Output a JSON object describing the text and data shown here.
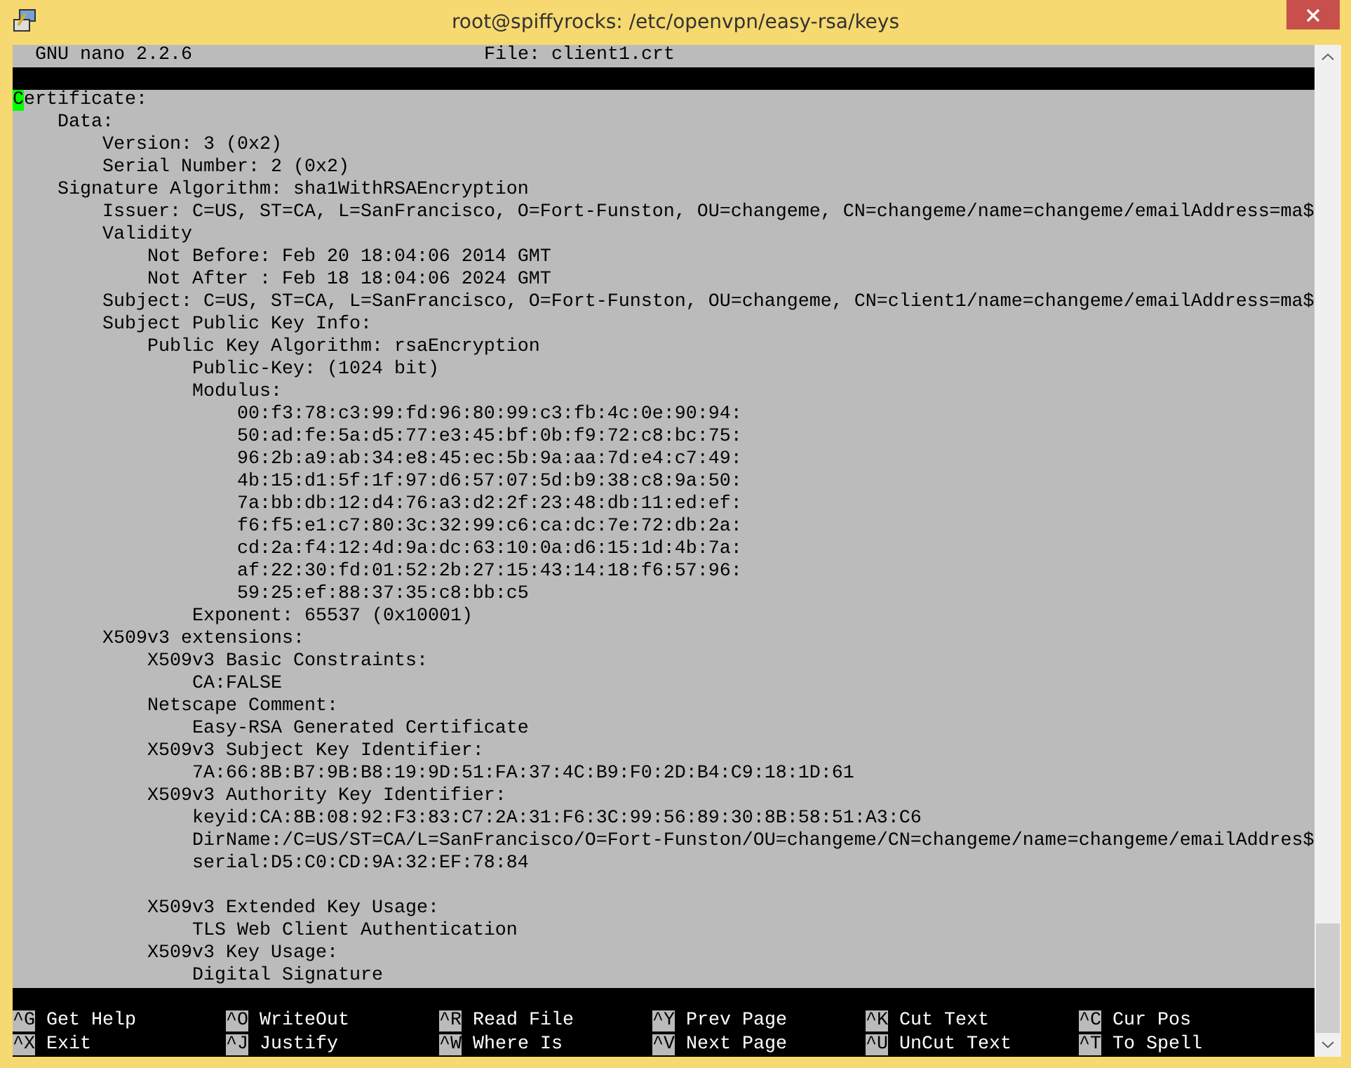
{
  "window": {
    "title": "root@spiffyrocks: /etc/openvpn/easy-rsa/keys"
  },
  "header": {
    "app": "  GNU nano 2.2.6",
    "file": "File: client1.crt"
  },
  "lines": [
    {
      "kind": "text",
      "text": "Certificate:",
      "has_cursor": true
    },
    {
      "kind": "text",
      "text": "    Data:",
      "has_cursor": false
    },
    {
      "kind": "text",
      "text": "        Version: 3 (0x2)",
      "has_cursor": false
    },
    {
      "kind": "text",
      "text": "        Serial Number: 2 (0x2)",
      "has_cursor": false
    },
    {
      "kind": "text",
      "text": "    Signature Algorithm: sha1WithRSAEncryption",
      "has_cursor": false
    },
    {
      "kind": "text",
      "text": "        Issuer: C=US, ST=CA, L=SanFrancisco, O=Fort-Funston, OU=changeme, CN=changeme/name=changeme/emailAddress=ma$",
      "has_cursor": false
    },
    {
      "kind": "text",
      "text": "        Validity",
      "has_cursor": false
    },
    {
      "kind": "text",
      "text": "            Not Before: Feb 20 18:04:06 2014 GMT",
      "has_cursor": false
    },
    {
      "kind": "text",
      "text": "            Not After : Feb 18 18:04:06 2024 GMT",
      "has_cursor": false
    },
    {
      "kind": "text",
      "text": "        Subject: C=US, ST=CA, L=SanFrancisco, O=Fort-Funston, OU=changeme, CN=client1/name=changeme/emailAddress=ma$",
      "has_cursor": false
    },
    {
      "kind": "text",
      "text": "        Subject Public Key Info:",
      "has_cursor": false
    },
    {
      "kind": "text",
      "text": "            Public Key Algorithm: rsaEncryption",
      "has_cursor": false
    },
    {
      "kind": "text",
      "text": "                Public-Key: (1024 bit)",
      "has_cursor": false
    },
    {
      "kind": "text",
      "text": "                Modulus:",
      "has_cursor": false
    },
    {
      "kind": "text",
      "text": "                    00:f3:78:c3:99:fd:96:80:99:c3:fb:4c:0e:90:94:",
      "has_cursor": false
    },
    {
      "kind": "text",
      "text": "                    50:ad:fe:5a:d5:77:e3:45:bf:0b:f9:72:c8:bc:75:",
      "has_cursor": false
    },
    {
      "kind": "text",
      "text": "                    96:2b:a9:ab:34:e8:45:ec:5b:9a:aa:7d:e4:c7:49:",
      "has_cursor": false
    },
    {
      "kind": "text",
      "text": "                    4b:15:d1:5f:1f:97:d6:57:07:5d:b9:38:c8:9a:50:",
      "has_cursor": false
    },
    {
      "kind": "text",
      "text": "                    7a:bb:db:12:d4:76:a3:d2:2f:23:48:db:11:ed:ef:",
      "has_cursor": false
    },
    {
      "kind": "text",
      "text": "                    f6:f5:e1:c7:80:3c:32:99:c6:ca:dc:7e:72:db:2a:",
      "has_cursor": false
    },
    {
      "kind": "text",
      "text": "                    cd:2a:f4:12:4d:9a:dc:63:10:0a:d6:15:1d:4b:7a:",
      "has_cursor": false
    },
    {
      "kind": "text",
      "text": "                    af:22:30:fd:01:52:2b:27:15:43:14:18:f6:57:96:",
      "has_cursor": false
    },
    {
      "kind": "text",
      "text": "                    59:25:ef:88:37:35:c8:bb:c5",
      "has_cursor": false
    },
    {
      "kind": "text",
      "text": "                Exponent: 65537 (0x10001)",
      "has_cursor": false
    },
    {
      "kind": "text",
      "text": "        X509v3 extensions:",
      "has_cursor": false
    },
    {
      "kind": "text",
      "text": "            X509v3 Basic Constraints:",
      "has_cursor": false
    },
    {
      "kind": "text",
      "text": "                CA:FALSE",
      "has_cursor": false
    },
    {
      "kind": "text",
      "text": "            Netscape Comment:",
      "has_cursor": false
    },
    {
      "kind": "text",
      "text": "                Easy-RSA Generated Certificate",
      "has_cursor": false
    },
    {
      "kind": "text",
      "text": "            X509v3 Subject Key Identifier:",
      "has_cursor": false
    },
    {
      "kind": "text",
      "text": "                7A:66:8B:B7:9B:B8:19:9D:51:FA:37:4C:B9:F0:2D:B4:C9:18:1D:61",
      "has_cursor": false
    },
    {
      "kind": "text",
      "text": "            X509v3 Authority Key Identifier:",
      "has_cursor": false
    },
    {
      "kind": "text",
      "text": "                keyid:CA:8B:08:92:F3:83:C7:2A:31:F6:3C:99:56:89:30:8B:58:51:A3:C6",
      "has_cursor": false
    },
    {
      "kind": "text",
      "text": "                DirName:/C=US/ST=CA/L=SanFrancisco/O=Fort-Funston/OU=changeme/CN=changeme/name=changeme/emailAddres$",
      "has_cursor": false
    },
    {
      "kind": "text",
      "text": "                serial:D5:C0:CD:9A:32:EF:78:84",
      "has_cursor": false
    },
    {
      "kind": "blank"
    },
    {
      "kind": "text",
      "text": "            X509v3 Extended Key Usage:",
      "has_cursor": false
    },
    {
      "kind": "text",
      "text": "                TLS Web Client Authentication",
      "has_cursor": false
    },
    {
      "kind": "text",
      "text": "            X509v3 Key Usage:",
      "has_cursor": false
    },
    {
      "kind": "text",
      "text": "                Digital Signature",
      "has_cursor": false
    }
  ],
  "shortcuts": [
    {
      "key": "^G",
      "label": "Get Help"
    },
    {
      "key": "^O",
      "label": "WriteOut"
    },
    {
      "key": "^R",
      "label": "Read File"
    },
    {
      "key": "^Y",
      "label": "Prev Page"
    },
    {
      "key": "^K",
      "label": "Cut Text"
    },
    {
      "key": "^C",
      "label": "Cur Pos"
    },
    {
      "key": "^X",
      "label": "Exit"
    },
    {
      "key": "^J",
      "label": "Justify"
    },
    {
      "key": "^W",
      "label": "Where Is"
    },
    {
      "key": "^V",
      "label": "Next Page"
    },
    {
      "key": "^U",
      "label": "UnCut Text"
    },
    {
      "key": "^T",
      "label": "To Spell"
    }
  ]
}
